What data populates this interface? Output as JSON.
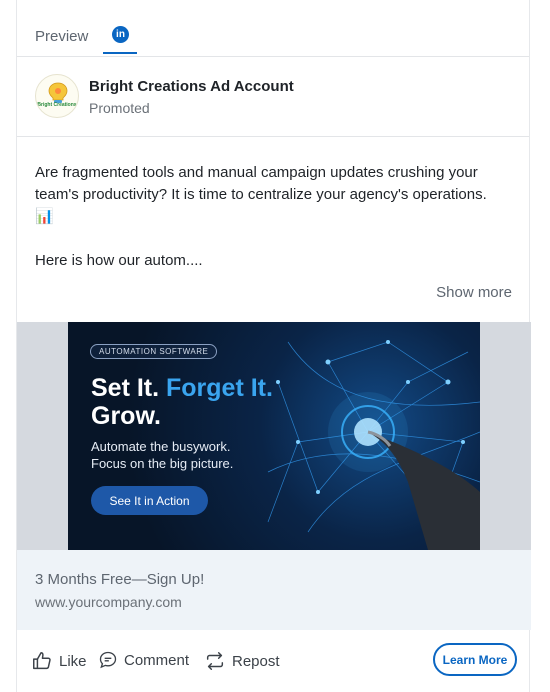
{
  "tabs": {
    "preview_label": "Preview",
    "active_network": "linkedin-icon"
  },
  "post": {
    "account_name": "Bright Creations Ad Account",
    "account_subtitle": "Promoted",
    "avatar_logo_text": "Bright Creations",
    "body_line1": "Are fragmented tools and manual campaign updates crushing your team's productivity? It is time to centralize your agency's operations. 📊",
    "body_line2": "Here is how our autom....",
    "show_more": "Show more"
  },
  "ad_creative": {
    "badge": "AUTOMATION SOFTWARE",
    "headline_part1": "Set It. ",
    "headline_accent": "Forget It.",
    "headline_line2": "Grow.",
    "subtext_line1": "Automate the busywork.",
    "subtext_line2": "Focus on the big picture.",
    "button": "See It in Action"
  },
  "cta": {
    "headline": "3 Months Free—Sign Up!",
    "url": "www.yourcompany.com"
  },
  "actions": {
    "like": "Like",
    "comment": "Comment",
    "repost": "Repost",
    "learn_more": "Learn More"
  },
  "colors": {
    "linkedin_blue": "#0a66c2",
    "accent": "#3aa5ef",
    "ad_bg": "#071528"
  }
}
